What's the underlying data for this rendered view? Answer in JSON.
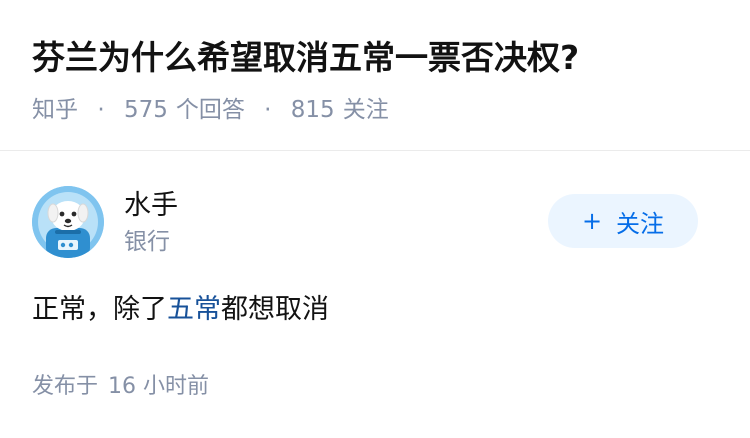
{
  "question": {
    "title": "芬兰为什么希望取消五常一票否决权?",
    "meta": {
      "site": "知乎",
      "separator": "·",
      "answers_count": "575",
      "answers_label": "个回答",
      "followers_count": "815",
      "followers_label": "关注"
    }
  },
  "author": {
    "name": "水手",
    "bio": "银行",
    "avatar_icon": "cartoon-dog-astronaut-avatar",
    "follow_label": "关注",
    "follow_icon": "plus-icon"
  },
  "answer": {
    "text_before": "正常，除了",
    "keyword": "五常",
    "text_after": "都想取消",
    "published_label": "发布于",
    "published_time": "16 小时前"
  },
  "colors": {
    "title": "#121212",
    "meta": "#8590a6",
    "follow_bg": "#ebf5ff",
    "follow_text": "#056de8",
    "keyword_link": "#175199",
    "avatar_bg": "#8ccbf2"
  }
}
